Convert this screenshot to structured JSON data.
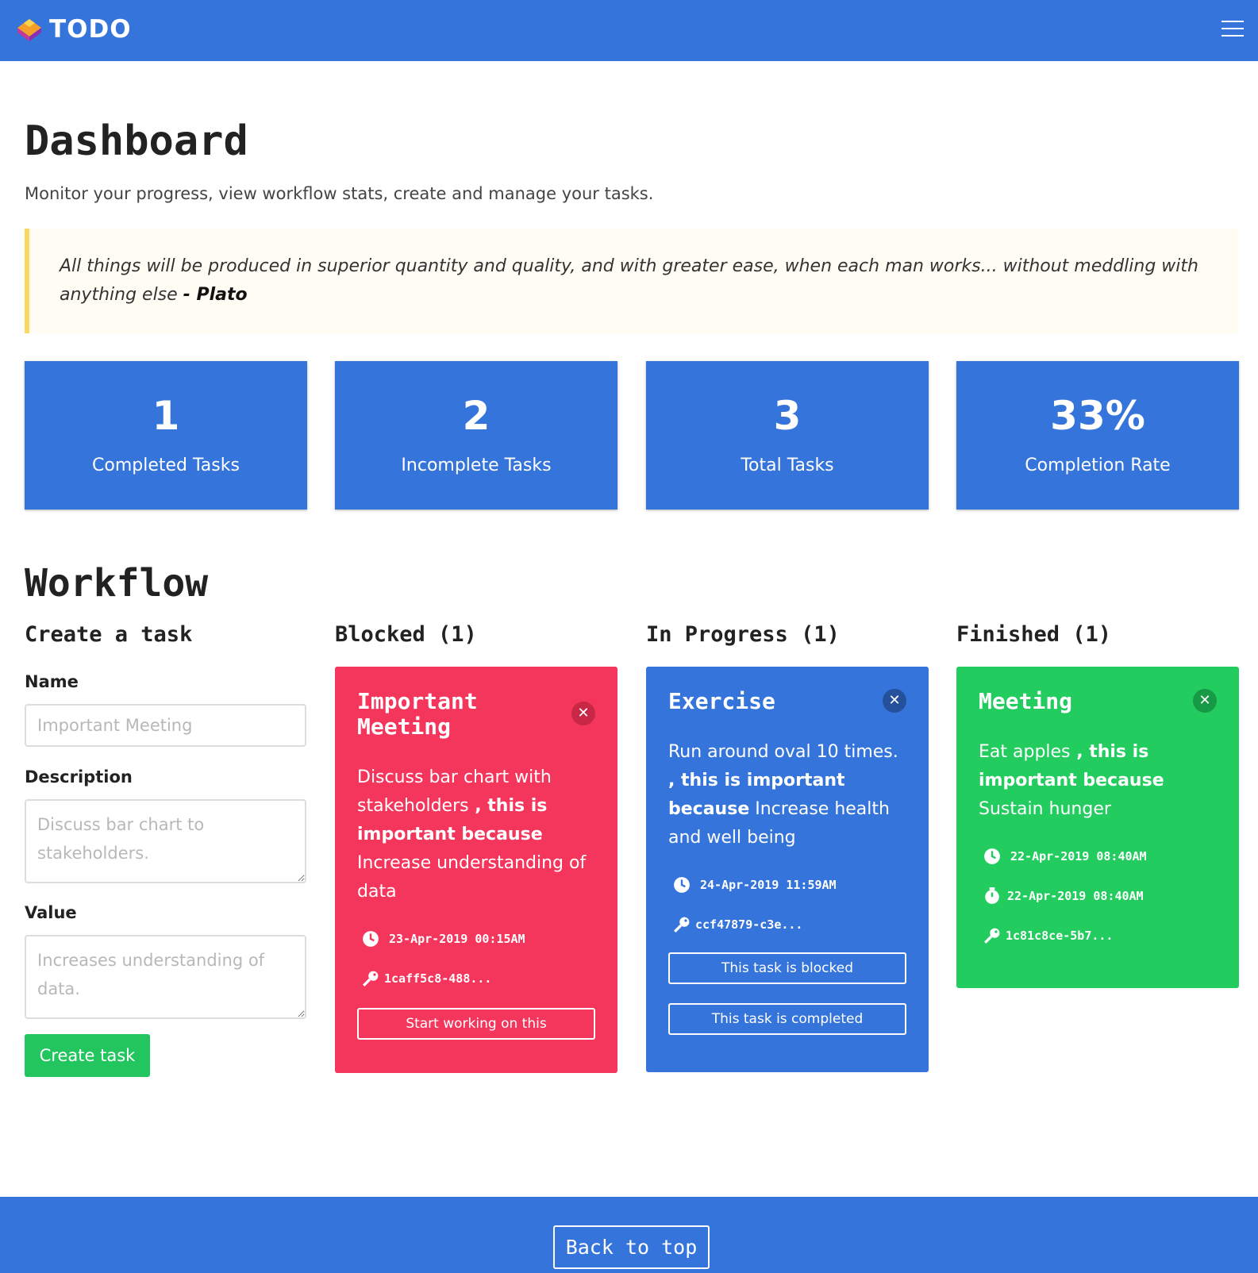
{
  "navbar": {
    "brand": "TODO",
    "menu_icon": "hamburger-menu-icon",
    "color": "#3574da"
  },
  "header": {
    "title": "Dashboard",
    "subtitle": "Monitor your progress, view workflow stats, create and manage your tasks."
  },
  "quote": {
    "text": "All things will be produced in superior quantity and quality, and with greater ease, when each man works... without meddling with anything else",
    "author": "- Plato"
  },
  "stats": [
    {
      "value": "1",
      "label": "Completed Tasks"
    },
    {
      "value": "2",
      "label": "Incomplete Tasks"
    },
    {
      "value": "3",
      "label": "Total Tasks"
    },
    {
      "value": "33%",
      "label": "Completion Rate"
    }
  ],
  "workflow": {
    "title": "Workflow",
    "create": {
      "title": "Create a task",
      "name_label": "Name",
      "name_placeholder": "Important Meeting",
      "description_label": "Description",
      "description_placeholder": "Discuss bar chart to stakeholders.",
      "value_label": "Value",
      "value_placeholder": "Increases understanding of data.",
      "button": "Create task"
    },
    "columns": {
      "blocked": {
        "title": "Blocked (1)"
      },
      "in_progress": {
        "title": "In Progress (1)"
      },
      "finished": {
        "title": "Finished (1)"
      }
    },
    "cards": {
      "blocked": {
        "title": "Important Meeting",
        "desc": "Discuss bar chart with stakeholders",
        "connector": " , this is important because",
        "value": "Increase understanding of data",
        "date": "23-Apr-2019 00:15AM",
        "id": "1caff5c8-488...",
        "button": "Start working on this",
        "color": "#f5365c"
      },
      "in_progress": {
        "title": "Exercise",
        "desc": "Run around oval 10 times.",
        "connector": " , this is important because",
        "value": "Increase health and well being",
        "date": "24-Apr-2019 11:59AM",
        "id": "ccf47879-c3e...",
        "button_blocked": "This task is blocked",
        "button_completed": "This task is completed",
        "color": "#3574da"
      },
      "finished": {
        "title": "Meeting",
        "desc": "Eat apples",
        "connector": " , this is important because",
        "value": "Sustain hunger",
        "date": "22-Apr-2019 08:40AM",
        "finished_date": "22-Apr-2019 08:40AM",
        "id": "1c81c8ce-5b7...",
        "color": "#22cc5e"
      }
    }
  },
  "footer": {
    "back_to_top": "Back to top"
  }
}
